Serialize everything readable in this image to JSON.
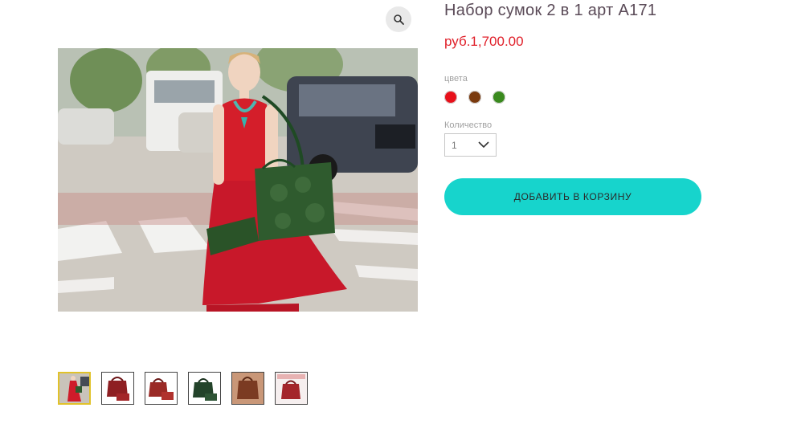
{
  "product": {
    "title": "Набор сумок 2 в 1 арт А171",
    "price": "руб.1,700.00",
    "color_label": "цвета",
    "colors": [
      "#e8101a",
      "#7a3a0e",
      "#3a8a1e"
    ],
    "quantity_label": "Количество",
    "quantity_value": "1",
    "add_to_cart_label": "ДОБАВИТЬ В КОРЗИНУ"
  },
  "gallery": {
    "zoom_icon": "magnifier-icon",
    "thumbnails": [
      {
        "name": "thumb-red-dress-model",
        "selected": true
      },
      {
        "name": "thumb-red-bag-set-1",
        "selected": false
      },
      {
        "name": "thumb-red-bag-set-2",
        "selected": false
      },
      {
        "name": "thumb-green-bag-set",
        "selected": false
      },
      {
        "name": "thumb-brown-bag",
        "selected": false
      },
      {
        "name": "thumb-red-bag-box",
        "selected": false
      }
    ]
  }
}
